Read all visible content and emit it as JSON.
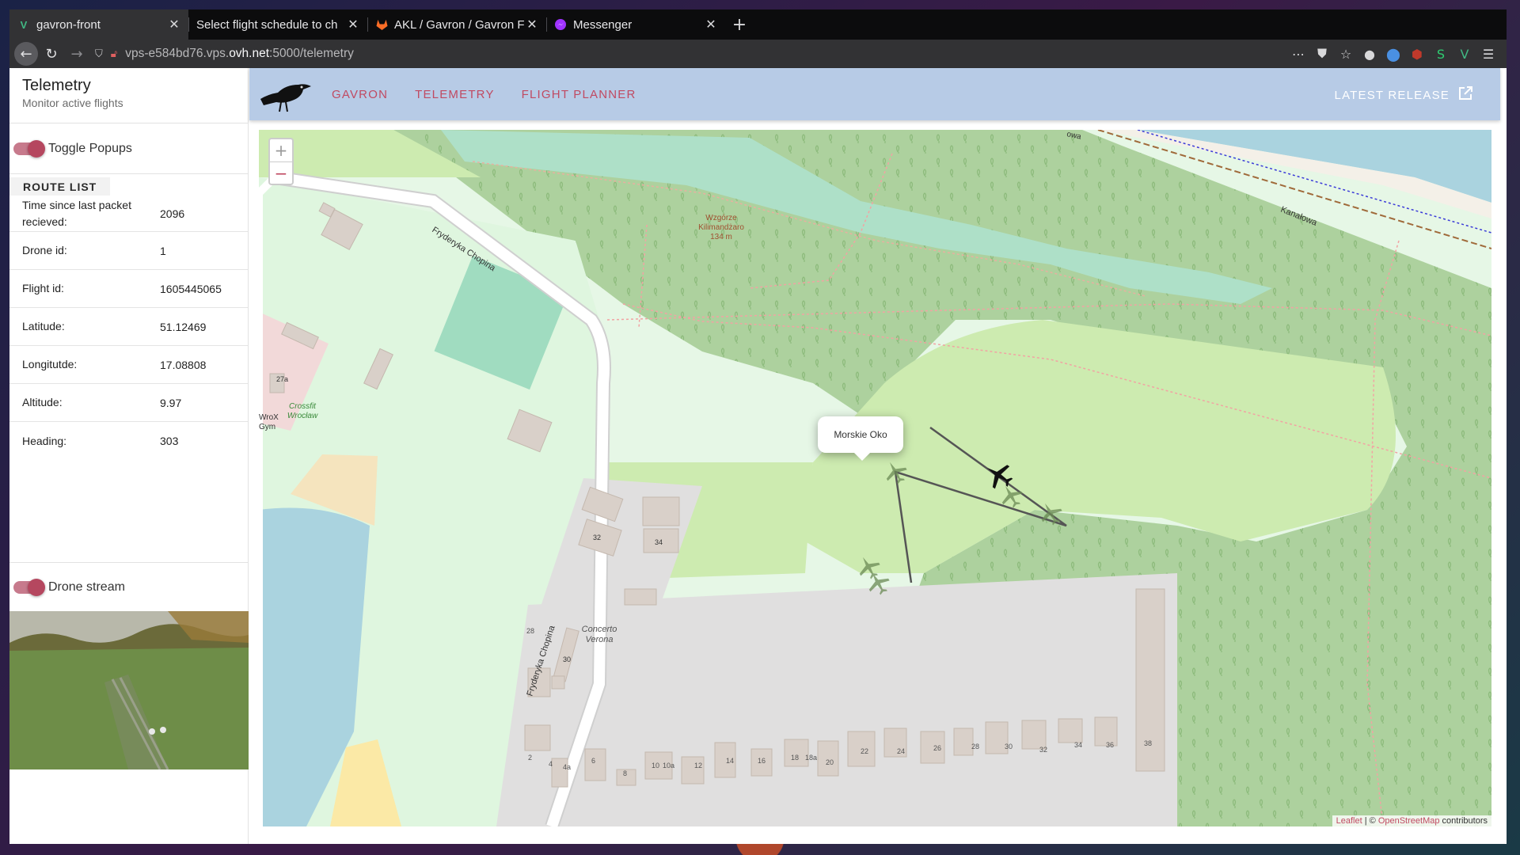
{
  "browser": {
    "tabs": [
      {
        "title": "gavron-front",
        "icon": "vue-icon",
        "active": true
      },
      {
        "title": "Select flight schedule to ch",
        "icon": "none",
        "active": false
      },
      {
        "title": "AKL / Gavron / Gavron F",
        "icon": "gitlab-icon",
        "active": false
      },
      {
        "title": "Messenger",
        "icon": "messenger-icon",
        "active": false
      }
    ],
    "url_prefix": "vps-e584bd76.vps.",
    "url_host": "ovh.net",
    "url_suffix": ":5000/telemetry"
  },
  "sidebar": {
    "title": "Telemetry",
    "subtitle": "Monitor active flights",
    "toggle_popups_label": "Toggle Popups",
    "route_list_label": "ROUTE LIST",
    "telemetry": [
      {
        "label": "Time since last packet recieved:",
        "value": "2096"
      },
      {
        "label": "Drone id:",
        "value": "1"
      },
      {
        "label": "Flight id:",
        "value": "1605445065"
      },
      {
        "label": "Latitude:",
        "value": "51.12469"
      },
      {
        "label": "Longitutde:",
        "value": "17.08808"
      },
      {
        "label": "Altitude:",
        "value": "9.97"
      },
      {
        "label": "Heading:",
        "value": "303"
      }
    ],
    "drone_stream_label": "Drone stream"
  },
  "appbar": {
    "nav": [
      "GAVRON",
      "TELEMETRY",
      "FLIGHT PLANNER"
    ],
    "latest_release": "LATEST RELEASE"
  },
  "map": {
    "zoom_in": "+",
    "zoom_out": "−",
    "popup_text": "Morskie Oko",
    "labels": {
      "street_chopina_1": "Fryderyka Chopina",
      "street_chopina_2": "Fryderyka Chopina",
      "street_kanalowa": "Kanałowa",
      "street_top": "owa",
      "hill_name_1": "Wzgórze",
      "hill_name_2": "Kilimandżaro",
      "hill_height": "134 m",
      "gym_1": "Crossfit",
      "gym_2": "Wrocław",
      "gym_other_1": "WroX",
      "gym_other_2": "Gym",
      "building_27a": "27a",
      "building_32": "32",
      "building_34": "34",
      "building_30": "30",
      "concerto_1": "Concerto",
      "concerto_2": "Verona",
      "house_numbers": [
        "2",
        "4",
        "4a",
        "6",
        "8",
        "10",
        "10a",
        "12",
        "14",
        "16",
        "18",
        "18a",
        "20",
        "22",
        "24",
        "26",
        "28",
        "30",
        "32",
        "34",
        "36",
        "38",
        "28"
      ]
    },
    "attribution_leaflet": "Leaflet",
    "attribution_sep": " | © ",
    "attribution_osm": "OpenStreetMap",
    "attribution_tail": " contributors"
  },
  "colors": {
    "accent": "#c04a62",
    "appbar": "#b7cbe6",
    "forest": "#add19e",
    "park": "#c8facc",
    "water": "#aad3df"
  }
}
